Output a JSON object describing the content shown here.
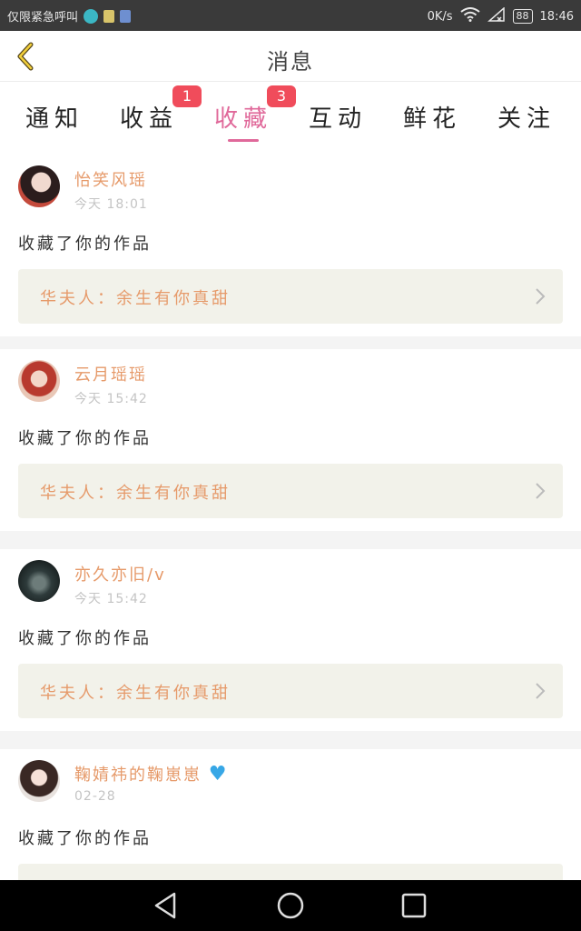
{
  "status_bar": {
    "carrier_text": "仅限紧急呼叫",
    "net_speed": "0K/s",
    "battery": "88",
    "time": "18:46",
    "icons": [
      "moon-app-icon",
      "sim-icon",
      "storage-icon",
      "wifi-icon",
      "signal-icon",
      "battery-icon"
    ]
  },
  "header": {
    "title": "消息",
    "back_icon": "chevron-left-icon",
    "accent_color": "#e0699a"
  },
  "tabs": [
    {
      "label": "通知",
      "badge": ""
    },
    {
      "label": "收益",
      "badge": "1"
    },
    {
      "label": "收藏",
      "badge": "3",
      "active": true
    },
    {
      "label": "互动",
      "badge": ""
    },
    {
      "label": "鲜花",
      "badge": ""
    },
    {
      "label": "关注",
      "badge": ""
    }
  ],
  "feed": [
    {
      "username": "怡笑风瑶",
      "time": "今天 18:01",
      "action": "收藏了你的作品",
      "work": "华夫人：余生有你真甜"
    },
    {
      "username": "云月瑶瑶",
      "time": "今天 15:42",
      "action": "收藏了你的作品",
      "work": "华夫人：余生有你真甜"
    },
    {
      "username": "亦久亦旧/v",
      "time": "今天 15:42",
      "action": "收藏了你的作品",
      "work": "华夫人：余生有你真甜"
    },
    {
      "username": "鞠婧祎的鞠崽崽",
      "time": "02-28",
      "action": "收藏了你的作品",
      "work": ""
    }
  ],
  "navbar": {
    "back": "triangle-back-icon",
    "home": "circle-home-icon",
    "recents": "square-recents-icon"
  }
}
